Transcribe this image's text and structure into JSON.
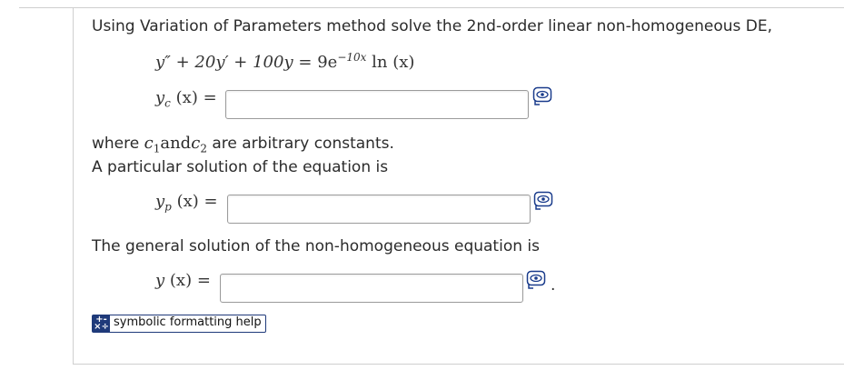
{
  "question": {
    "intro": "Using Variation of Parameters method solve the 2nd-order linear non-homogeneous DE,",
    "equation": {
      "lhs": "y″ + 20y′ + 100y",
      "eq": "=",
      "rhs_coef": "9e",
      "rhs_exp": "−10x",
      "rhs_log": " ln (x)"
    },
    "yc_label": {
      "var": "y",
      "sub": "c",
      "arg": "(x)",
      "eq": "="
    },
    "constants_note": {
      "prefix": "where",
      "c1": "c",
      "c1_sub": "1",
      "and": "and",
      "c2": "c",
      "c2_sub": "2",
      "suffix": "are arbitrary constants."
    },
    "particular_intro": "A particular solution of the equation is",
    "yp_label": {
      "var": "y",
      "sub": "p",
      "arg": "(x)",
      "eq": "="
    },
    "general_intro": "The general solution of the non-homogeneous equation is",
    "y_label": {
      "var": "y",
      "arg": "(x)",
      "eq": "="
    },
    "trailing_period": "."
  },
  "inputs": {
    "yc": {
      "value": ""
    },
    "yp": {
      "value": ""
    },
    "y": {
      "value": ""
    }
  },
  "help": {
    "label": "symbolic formatting help",
    "icon": "plus-minus-times-icon"
  },
  "colors": {
    "help_accent": "#1f3a7a",
    "preview_blue": "#1a3c8c",
    "border": "#9b9b9b"
  }
}
